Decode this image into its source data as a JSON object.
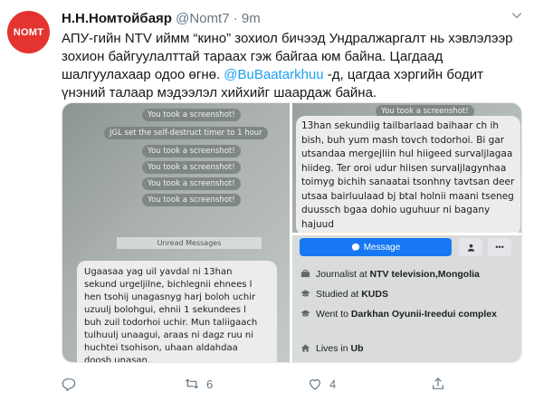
{
  "avatar": {
    "text": "NOMT"
  },
  "tweet": {
    "author": "Н.Н.Номтойбаяр",
    "handle": "@Nomt7",
    "separator": "·",
    "time": "9m",
    "text_part1": "АПУ-гийн NTV иймм “кино” зохиол бичээд Ундралжаргалт нь хэвлэлээр зохион байгуулалттай тараах гэж байгаа юм байна. Цагдаад шалгуулахаар одоо өгнө. ",
    "mention": "@BuBaatarkhuu",
    "text_part2": " -д, цагдаа хэргийн бодит үнэний талаар мэдээлэл хийхийг шаардаж байна."
  },
  "left_photo": {
    "pills": [
      "You took a screenshot!",
      "JGL set the self-destruct timer to 1 hour",
      "You took a screenshot!",
      "You took a screenshot!",
      "You took a screenshot!",
      "You took a screenshot!"
    ],
    "unread": "Unread Messages",
    "message": "Ugaasaa yag uil yavdal ni 13han\nsekund urgeljilne, bichlegnii ehnees l\nhen tsohij unagasnyg harj boloh uchir\nuzuulj bolohgui, ehnii 1 sekundees l\nbuh zuil todorhoi uchir. Mun taliigaach\ntulhuulj unaagui, araas ni dagz ruu ni\nhuchtei tsohison, uhaan aldahdaa\ndoosh unasan.."
  },
  "right_top": {
    "pill": "You took a screenshot!",
    "message": "13han sekundiig tailbarlaad baihaar ch ih bish, buh yum mash tovch todorhoi. Bi gar utsandaa mergejliin hul hiigeed survaljlagaa hiideg. Ter oroi udur hiisen survaljlagynhaa toimyg bichih sanaatai tsonhny tavtsan deer utsaa bairluulaad bj btal holnii maani tseneg duussch bgaa dohio uguhuur ni bagany hajuud"
  },
  "profile": {
    "message_button": "Message",
    "work_prefix": "Journalist at ",
    "work_place": "NTV television,Mongolia",
    "study_prefix": "Studied at ",
    "study_place": "KUDS",
    "went_prefix": "Went to ",
    "went_place": "Darkhan Oyunii-Ireedui complex",
    "lives_prefix": "Lives in ",
    "lives_place": "Ub"
  },
  "actions": {
    "reply": "",
    "retweet": "6",
    "like": "4",
    "share": ""
  },
  "colors": {
    "link": "#1da1f2",
    "text": "#14171a",
    "muted": "#657786",
    "avatar_bg": "#e3342f",
    "fb_blue": "#1877f2"
  }
}
